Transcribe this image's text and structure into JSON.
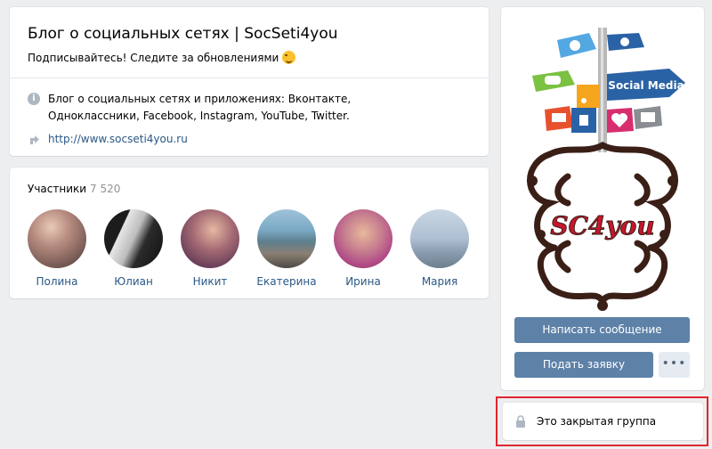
{
  "header": {
    "title": "Блог о социальных сетях | SocSeti4you",
    "status": "Подписывайтесь! Следите за обновлениями",
    "description": "Блог о социальных сетях и приложениях: Вконтакте, Одноклассники, Facebook, Instagram, YouTube, Twitter.",
    "link": "http://www.socseti4you.ru"
  },
  "members": {
    "label": "Участники",
    "count": "7 520",
    "items": [
      {
        "name": "Полина"
      },
      {
        "name": "Юлиан"
      },
      {
        "name": "Никит"
      },
      {
        "name": "Екатерина"
      },
      {
        "name": "Ирина"
      },
      {
        "name": "Мария"
      }
    ]
  },
  "side": {
    "logo_sign_label": "Social Media",
    "logo_text": "SC4you",
    "message_button": "Написать сообщение",
    "apply_button": "Подать заявку",
    "more_button": "•••"
  },
  "closed": {
    "text": "Это закрытая группа"
  },
  "colors": {
    "accent": "#5e81a8",
    "link": "#2a5885",
    "background": "#edeef0",
    "highlight": "#e0262e"
  }
}
